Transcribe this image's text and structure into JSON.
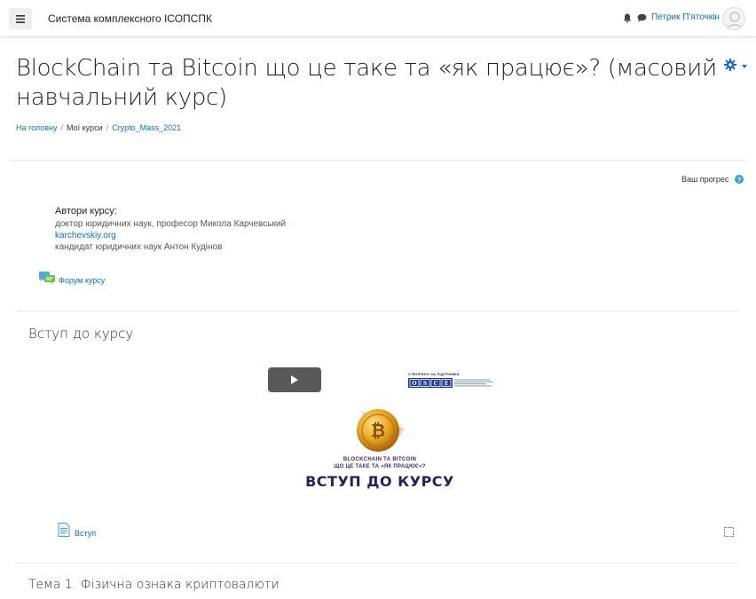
{
  "navbar": {
    "site_name": "Система комплексного ІСОПСПК",
    "user_name": "Петрик П'яточкін",
    "icons": [
      "menu-icon",
      "bell-icon",
      "chat-icon",
      "avatar"
    ]
  },
  "course": {
    "title": "BlockChain та Bitcoin що це таке та «як працює»? (масовий навчальний курс)",
    "breadcrumb": [
      {
        "label": "На головну"
      },
      {
        "label": "Мої курси"
      },
      {
        "label": "Crypto_Mass_2021"
      }
    ],
    "progress_label": "Ваш прогрес"
  },
  "authors": {
    "title": "Автори курсу:",
    "line1": "доктор юридичних наук, професор Микола Карчевський",
    "link": "karchevskiy.org",
    "line2": "кандидат юридичних наук Антон Кудінов"
  },
  "forum": {
    "label": "Форум курсу"
  },
  "section1": {
    "title": "Вступ до курсу",
    "video": {
      "osce_caption": "СТВОРЕНО ЗА ПІДТРИМКИ",
      "osce_logo": "OSCE",
      "line1": "BLOCKCHAIN ТА BITCOIN",
      "line2": "ЩО ЦЕ ТАКЕ ТА «ЯК ПРАЦЮЄ»?",
      "headline": "ВСТУП ДО КУРСУ"
    },
    "activity_label": "Вступ"
  },
  "section2": {
    "title": "Тема 1. Фізична ознака криптовалюти"
  },
  "colors": {
    "link": "#0f6cbf",
    "accent_purple": "#2a1f5c",
    "coin_gold": "#e8a820"
  }
}
